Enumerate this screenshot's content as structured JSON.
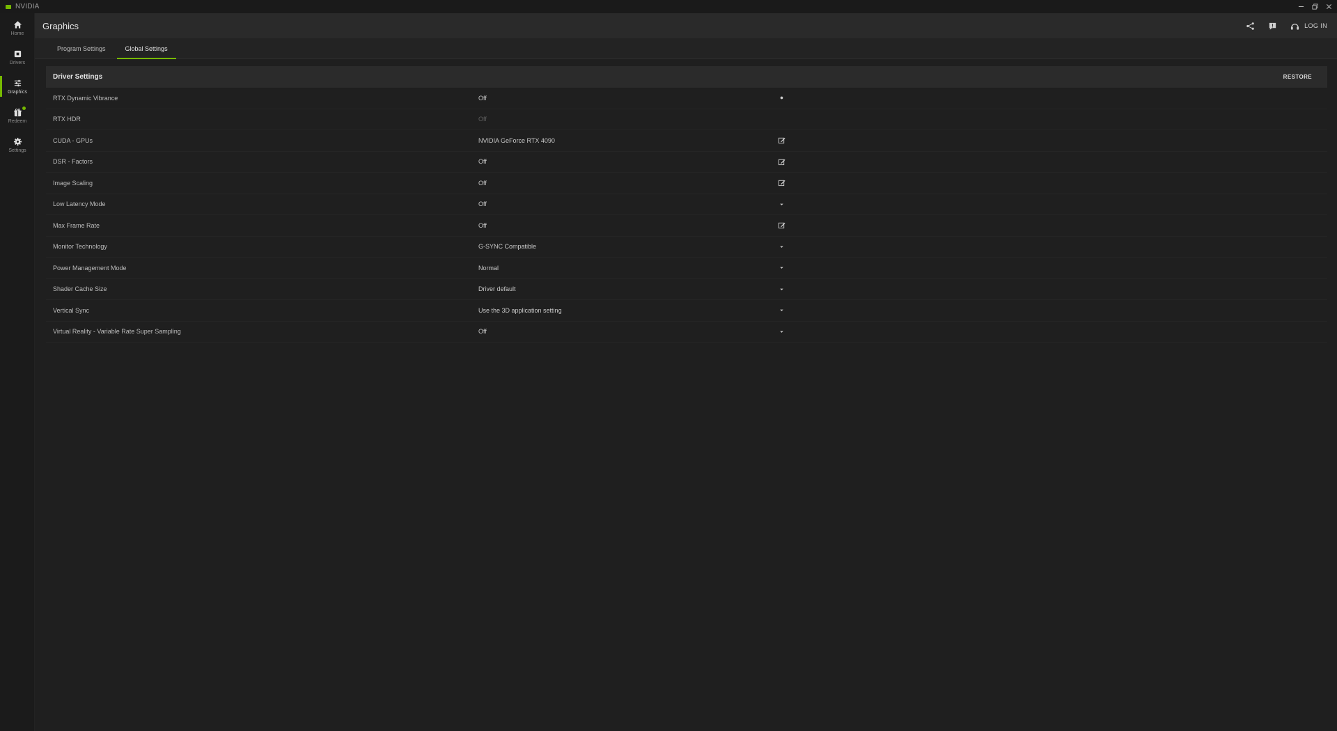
{
  "app": {
    "name": "NVIDIA"
  },
  "sidebar": {
    "items": [
      {
        "label": "Home",
        "icon": "home-icon"
      },
      {
        "label": "Drivers",
        "icon": "drivers-icon"
      },
      {
        "label": "Graphics",
        "icon": "sliders-icon",
        "active": true
      },
      {
        "label": "Redeem",
        "icon": "gift-icon",
        "badge": true
      },
      {
        "label": "Settings",
        "icon": "gear-icon"
      }
    ]
  },
  "header": {
    "title": "Graphics",
    "login_label": "LOG IN"
  },
  "tabs": [
    {
      "label": "Program Settings",
      "active": false
    },
    {
      "label": "Global Settings",
      "active": true
    }
  ],
  "section": {
    "title": "Driver Settings",
    "restore_label": "RESTORE"
  },
  "settings": [
    {
      "name": "RTX Dynamic Vibrance",
      "value": "Off",
      "control": "toggle"
    },
    {
      "name": "RTX HDR",
      "value": "Off",
      "control": "none",
      "disabled": true
    },
    {
      "name": "CUDA - GPUs",
      "value": "NVIDIA GeForce RTX 4090",
      "control": "edit"
    },
    {
      "name": "DSR - Factors",
      "value": "Off",
      "control": "edit"
    },
    {
      "name": "Image Scaling",
      "value": "Off",
      "control": "edit"
    },
    {
      "name": "Low Latency Mode",
      "value": "Off",
      "control": "dropdown"
    },
    {
      "name": "Max Frame Rate",
      "value": "Off",
      "control": "edit"
    },
    {
      "name": "Monitor Technology",
      "value": "G-SYNC Compatible",
      "control": "dropdown"
    },
    {
      "name": "Power Management Mode",
      "value": "Normal",
      "control": "dropdown"
    },
    {
      "name": "Shader Cache Size",
      "value": "Driver default",
      "control": "dropdown"
    },
    {
      "name": "Vertical Sync",
      "value": "Use the 3D application setting",
      "control": "dropdown"
    },
    {
      "name": "Virtual Reality - Variable Rate Super Sampling",
      "value": "Off",
      "control": "dropdown"
    }
  ],
  "colors": {
    "accent": "#76b900",
    "background": "#1f1f1f",
    "header": "#2a2a2a"
  }
}
